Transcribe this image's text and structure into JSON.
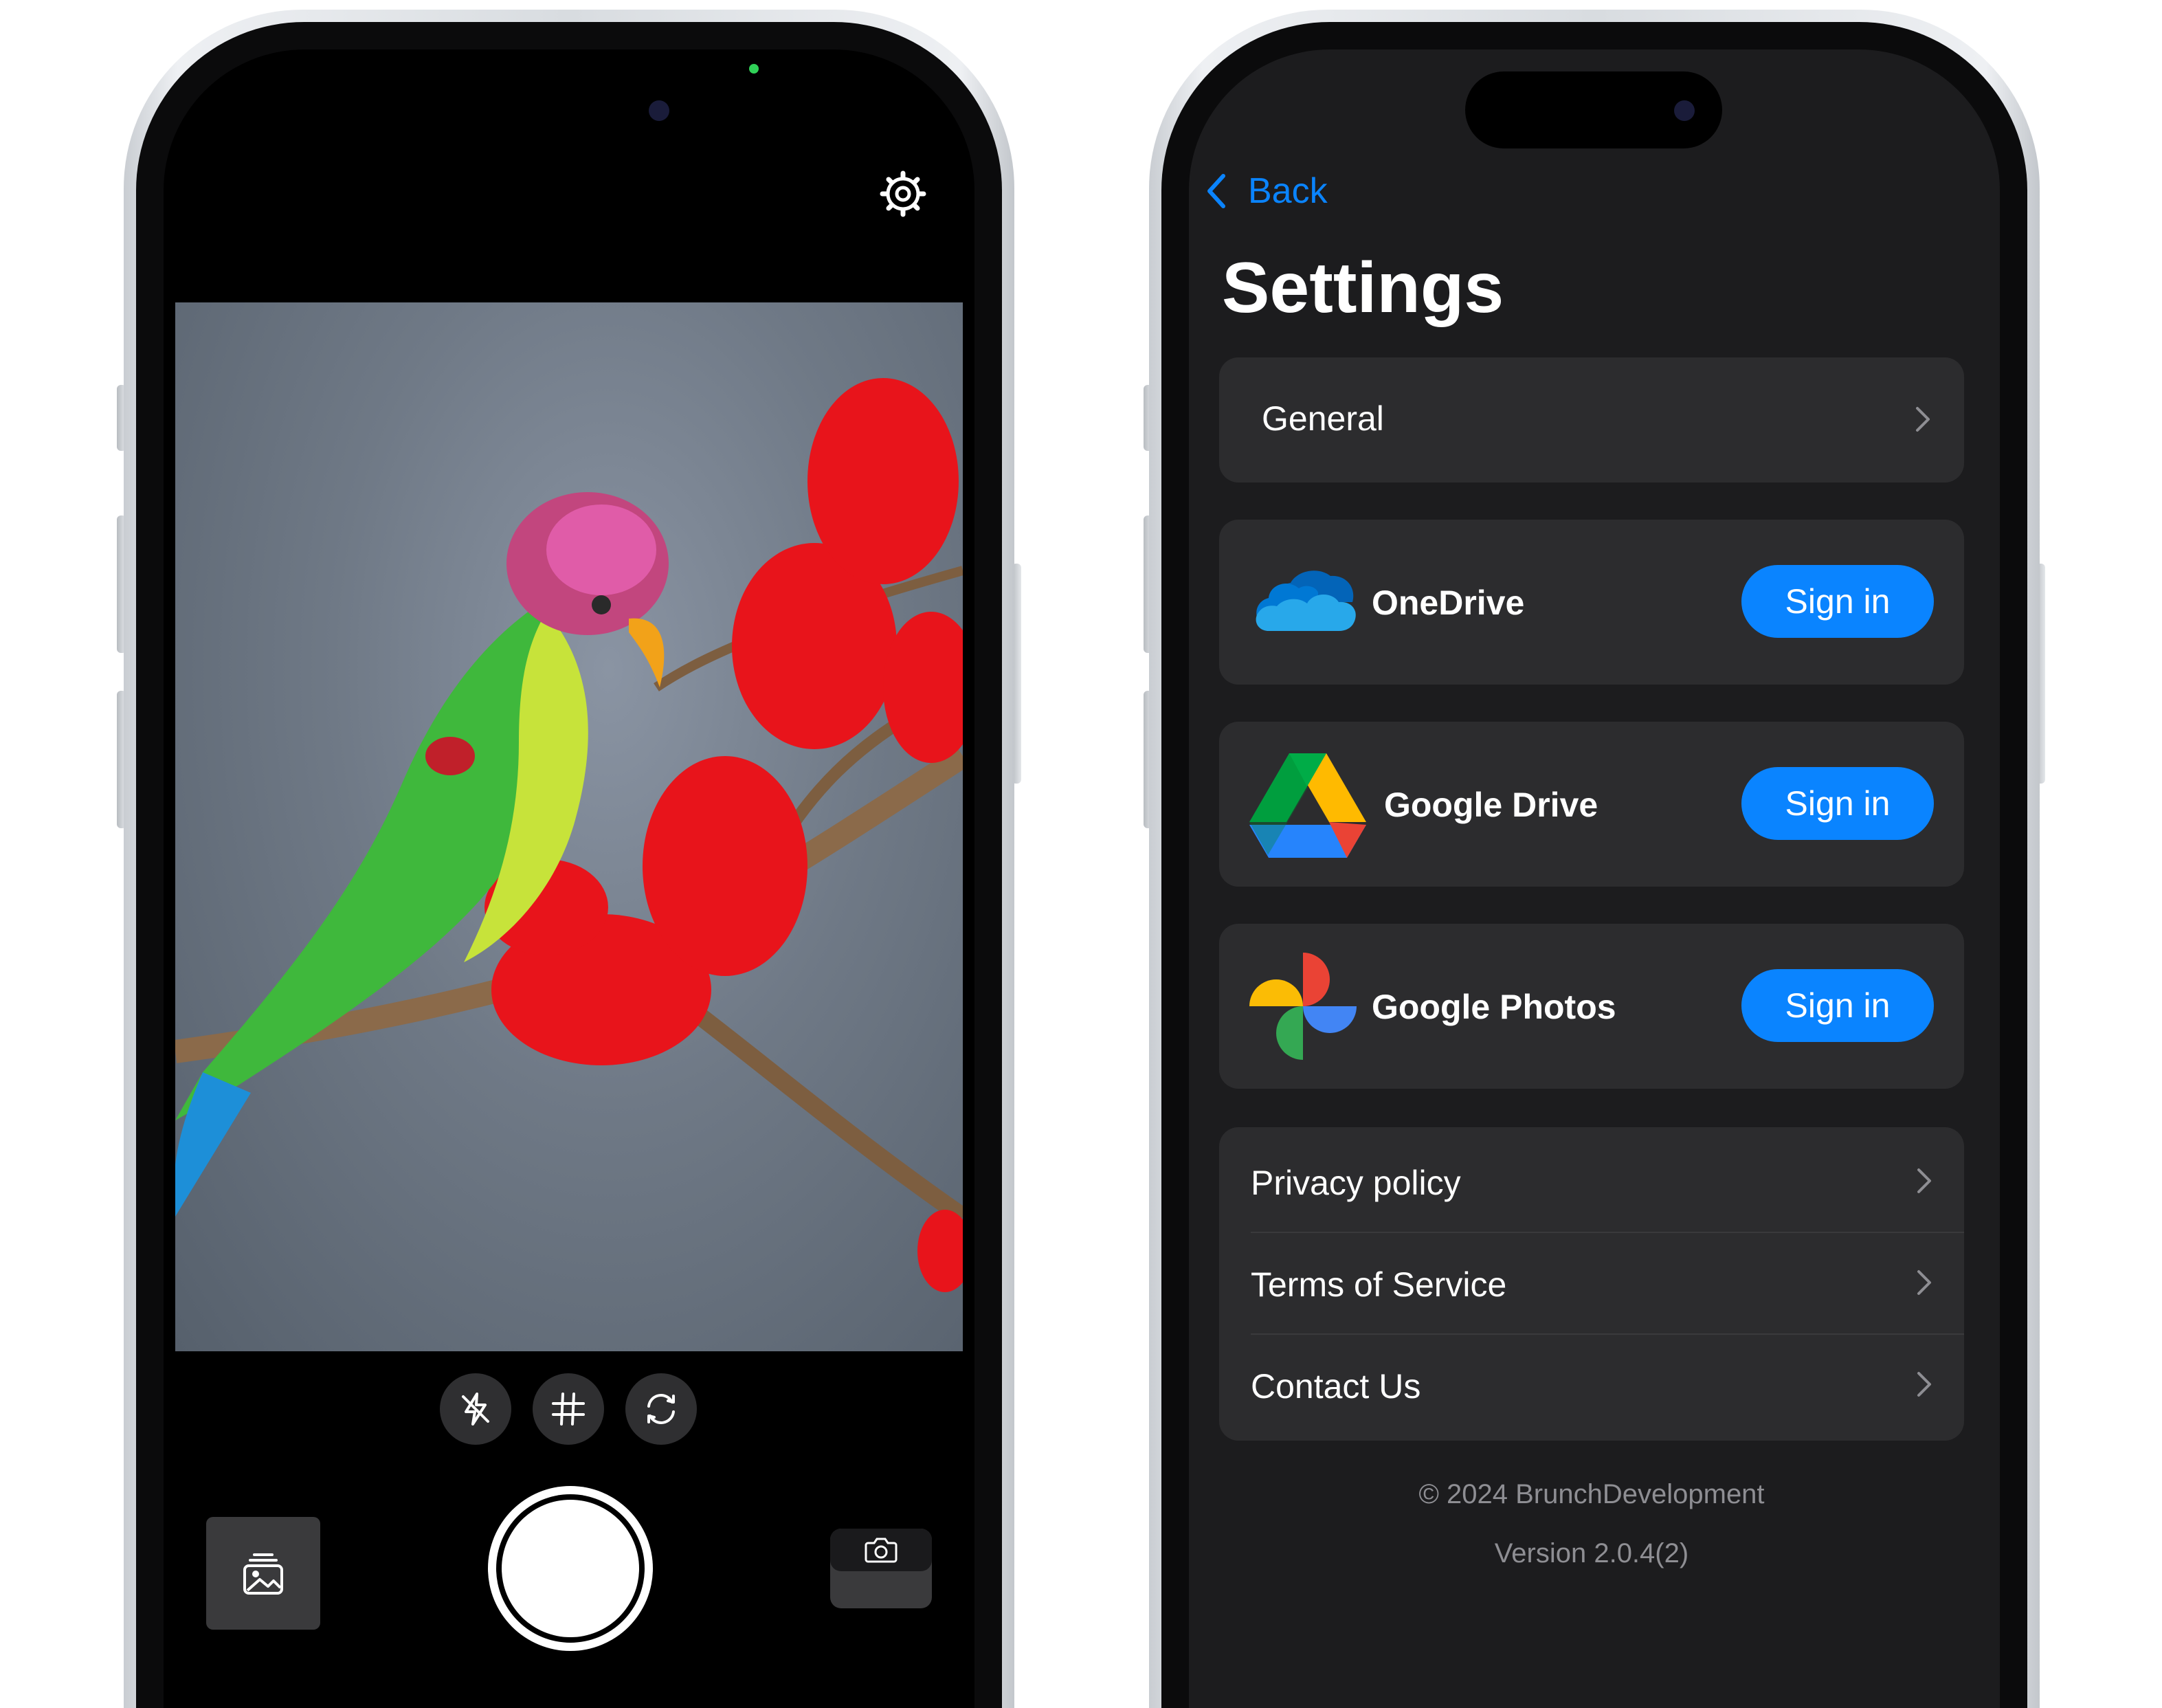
{
  "settings": {
    "back_label": "Back",
    "title": "Settings",
    "general_label": "General",
    "services": [
      {
        "name": "OneDrive",
        "action": "Sign in",
        "icon": "onedrive-icon"
      },
      {
        "name": "Google Drive",
        "action": "Sign in",
        "icon": "google-drive-icon"
      },
      {
        "name": "Google Photos",
        "action": "Sign in",
        "icon": "google-photos-icon"
      }
    ],
    "links": [
      {
        "label": "Privacy policy"
      },
      {
        "label": "Terms of Service"
      },
      {
        "label": "Contact Us"
      }
    ],
    "copyright": "© 2024 BrunchDevelopment",
    "version": "Version 2.0.4(2)"
  },
  "camera": {
    "icons": [
      "settings-gear-icon",
      "flash-off-icon",
      "grid-icon",
      "flip-camera-icon",
      "gallery-icon",
      "camera-icon"
    ]
  },
  "colors": {
    "accent": "#0a84ff",
    "background": "#1c1c1e",
    "card": "#2c2c2e"
  }
}
